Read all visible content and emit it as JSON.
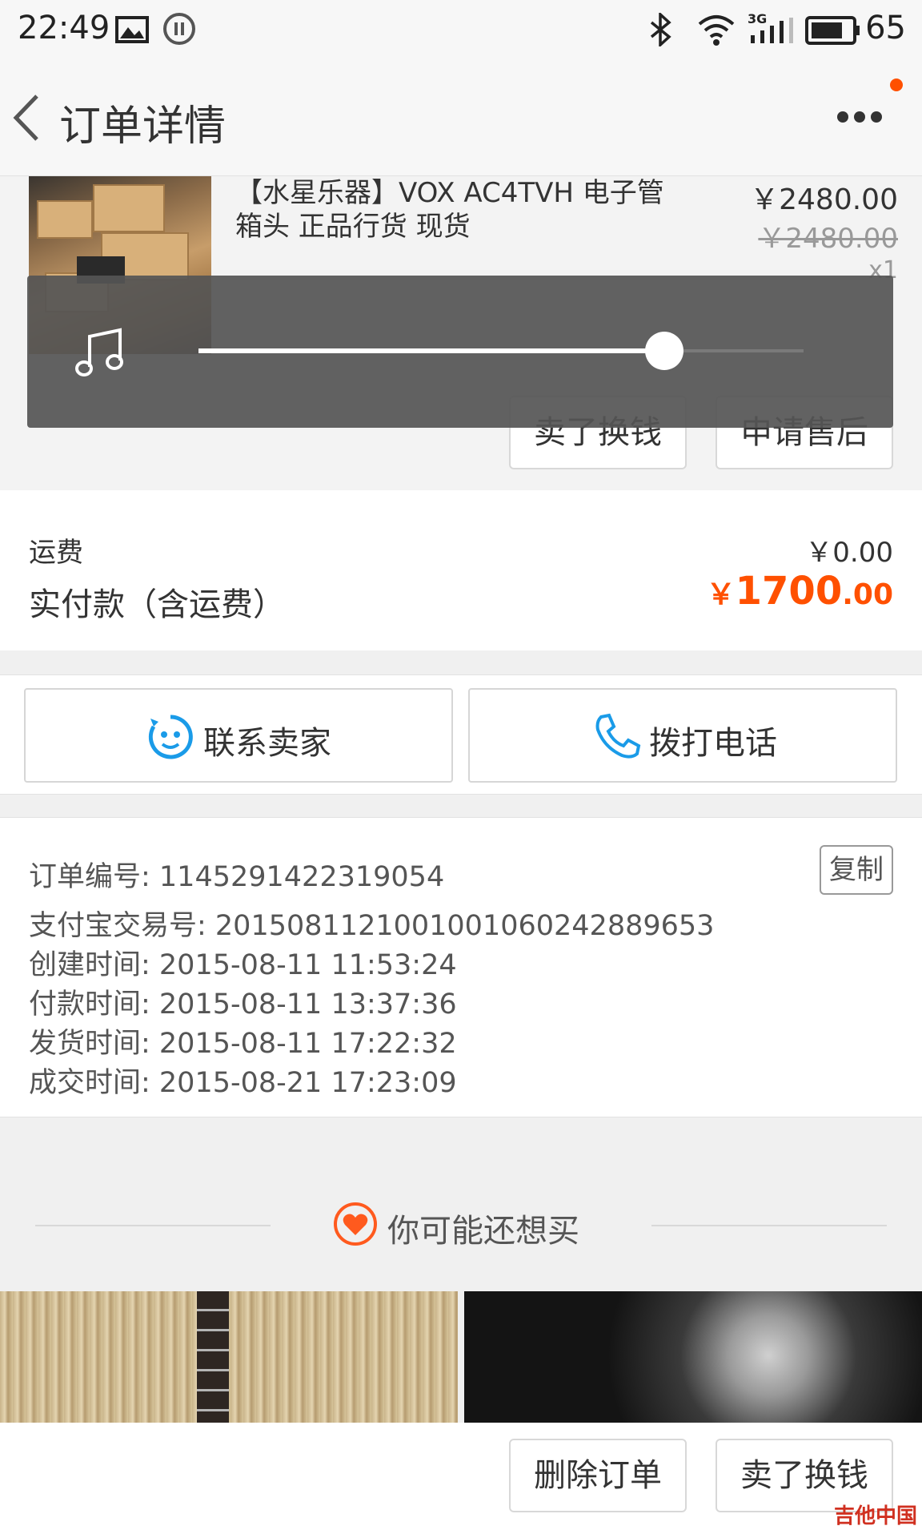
{
  "status_bar": {
    "time": "22:49",
    "battery": "65",
    "network": "3G",
    "icons": [
      "image-icon",
      "pause-icon",
      "bluetooth-icon",
      "wifi-icon",
      "signal-icon",
      "battery-icon"
    ]
  },
  "nav": {
    "title": "订单详情",
    "back_icon": "chevron-left-icon",
    "more_icon": "more-dots-icon"
  },
  "product": {
    "title": "【水星乐器】VOX AC4TVH 电子管箱头 正品行货 现货",
    "price": "￥2480.00",
    "original_price": "￥2480.00",
    "quantity": "x1",
    "sell_button": "卖了换钱",
    "after_sale_button": "申请售后"
  },
  "volume_overlay": {
    "icon": "music-note-icon",
    "level": 0.77
  },
  "totals": {
    "shipping_label": "运费",
    "shipping_value": "￥0.00",
    "paid_label": "实付款（含运费）",
    "paid_currency": "￥",
    "paid_integer": "1700",
    "paid_decimal": ".00"
  },
  "contact": {
    "seller_label": "联系卖家",
    "call_label": "拨打电话"
  },
  "order_info": {
    "order_no": "订单编号: 1145291422319054",
    "alipay_no": "支付宝交易号: 2015081121001001060242889653",
    "created": "创建时间: 2015-08-11 11:53:24",
    "paid": "付款时间: 2015-08-11 13:37:36",
    "shipped": "发货时间: 2015-08-11 17:22:32",
    "completed": "成交时间: 2015-08-21 17:23:09",
    "copy_button": "复制"
  },
  "recommend": {
    "title": "你可能还想买"
  },
  "bottom_bar": {
    "delete_button": "删除订单",
    "sell_button": "卖了换钱"
  },
  "watermark": "吉他中国"
}
